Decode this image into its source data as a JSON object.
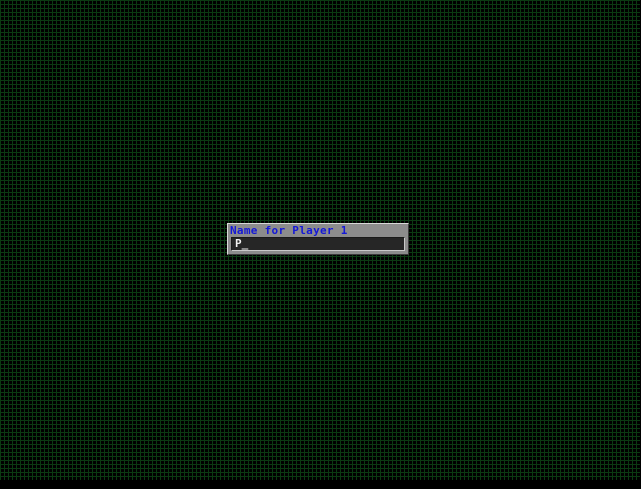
{
  "name_dialog": {
    "title": "Name for Player 1",
    "input_value": "P",
    "cursor": "_"
  },
  "colors": {
    "background": "#000000",
    "grid_line": "#0b3a12",
    "dialog_face": "#8c8c8c",
    "title_text": "#1418d8",
    "input_bg": "#262626",
    "input_text": "#f0f0f0"
  }
}
